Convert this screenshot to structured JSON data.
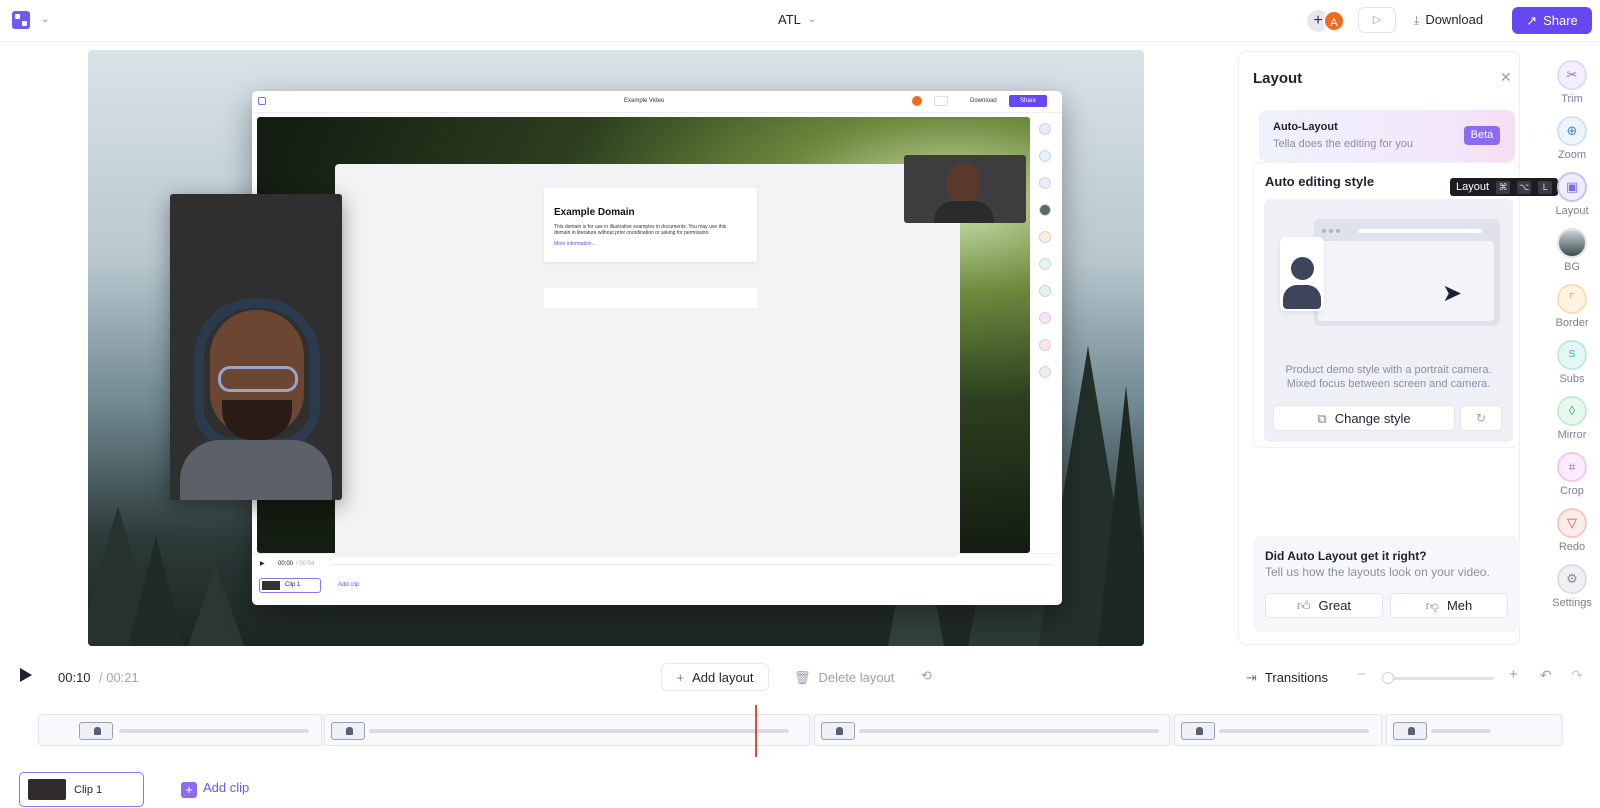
{
  "app": {
    "project_title": "ATL"
  },
  "topbar": {
    "add_collaborator_icon": "plus",
    "avatar_initial": "A",
    "avatar_color": "#ef6b24",
    "download_label": "Download",
    "share_label": "Share",
    "accent_color": "#6548f0"
  },
  "inner_preview": {
    "window_title": "Example Video",
    "download_label": "Download",
    "share_label": "Share",
    "domain_title": "Example Domain",
    "domain_body": "This domain is for use in illustrative examples in documents. You may use this domain in literature without prior coordination or asking for permission.",
    "domain_link": "More information...",
    "time_current": "00:00",
    "time_total": "/ 00:04",
    "clip_label": "Clip 1",
    "add_clip_label": "Add clip",
    "tool_labels": [
      "Trim",
      "Zoom",
      "Layout",
      "BG",
      "Border",
      "Subs",
      "Mirror",
      "Crop",
      "Redo",
      "Settings"
    ]
  },
  "panel": {
    "title": "Layout",
    "auto_layout": {
      "title": "Auto-Layout",
      "subtitle": "Tella does the editing for you",
      "badge": "Beta"
    },
    "editing_style": {
      "title": "Auto editing style",
      "description_line1": "Product demo style with a portrait camera.",
      "description_line2": "Mixed focus between screen and camera.",
      "change_style_label": "Change style"
    },
    "feedback": {
      "title": "Did Auto Layout get it right?",
      "subtitle": "Tell us how the layouts look on your video.",
      "great_label": "Great",
      "meh_label": "Meh"
    }
  },
  "tooltip": {
    "label": "Layout",
    "keys": [
      "⌘",
      "⌥",
      "L"
    ]
  },
  "tools": [
    {
      "label": "Trim",
      "icon": "trim-icon",
      "color": "#c9b5f5"
    },
    {
      "label": "Zoom",
      "icon": "zoom-icon",
      "color": "#8fc3ef"
    },
    {
      "label": "Layout",
      "icon": "layout-icon",
      "color": "#c9c3f5"
    },
    {
      "label": "BG",
      "icon": "bg-icon",
      "color": "#7f8e93"
    },
    {
      "label": "Border",
      "icon": "border-icon",
      "color": "#f5c77a"
    },
    {
      "label": "Subs",
      "icon": "subs-icon",
      "color": "#7fd6cf"
    },
    {
      "label": "Mirror",
      "icon": "mirror-icon",
      "color": "#88d6a3"
    },
    {
      "label": "Crop",
      "icon": "crop-icon",
      "color": "#f08bd9"
    },
    {
      "label": "Redo",
      "icon": "redo-icon",
      "color": "#ef6a5a"
    },
    {
      "label": "Settings",
      "icon": "settings-icon",
      "color": "#a7aab6"
    }
  ],
  "transport": {
    "time_current": "00:10",
    "time_total": "/ 00:21",
    "add_layout_label": "Add layout",
    "delete_layout_label": "Delete layout",
    "transitions_label": "Transitions",
    "zoom_level": 0
  },
  "timeline": {
    "playhead_color": "#e34a3c"
  },
  "clips": {
    "clip_label": "Clip 1",
    "add_clip_label": "Add clip"
  }
}
